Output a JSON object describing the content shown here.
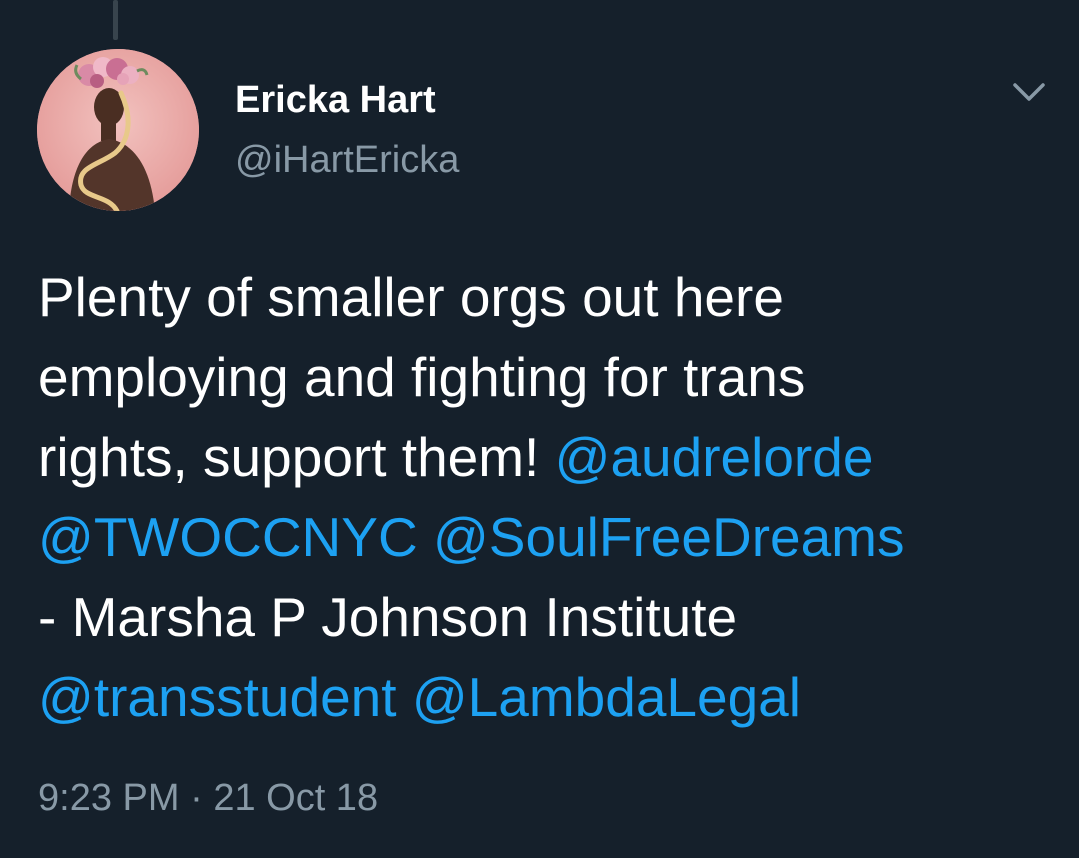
{
  "tweet": {
    "author": {
      "display_name": "Ericka Hart",
      "handle": "@iHartEricka",
      "avatar_icon": "profile-photo"
    },
    "menu_icon": "chevron-down-icon",
    "text_lines": [
      {
        "plain": "Plenty of smaller orgs out here"
      },
      {
        "plain": "employing and fighting for trans"
      },
      {
        "plain": "rights, support them! ",
        "mention": "@audrelorde"
      },
      {
        "mention": "@TWOCCNYC",
        "mention2": "@SoulFreeDreams"
      },
      {
        "plain": "- Marsha P Johnson Institute"
      },
      {
        "mention": "@transstudent",
        "mention2": "@LambdaLegal"
      }
    ],
    "time": "9:23 PM",
    "separator": "·",
    "date": "21 Oct 18"
  },
  "colors": {
    "background": "#15202b",
    "text": "#ffffff",
    "secondary_text": "#8899a6",
    "link": "#1da1f2"
  }
}
